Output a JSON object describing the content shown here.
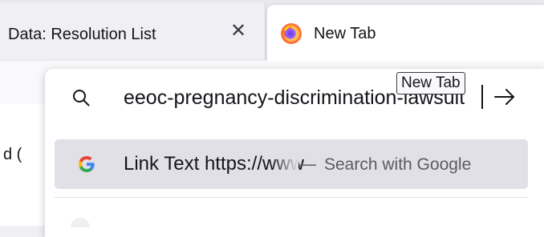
{
  "tabs": {
    "inactive": {
      "title": "Data: Resolution List",
      "close_icon": "close-icon"
    },
    "active": {
      "title": "New Tab",
      "icon": "firefox-icon"
    }
  },
  "tooltip": {
    "text": "New Tab"
  },
  "urlbar": {
    "value": "eeoc-pregnancy-discrimination-lawsuit",
    "search_icon": "search-icon",
    "go_icon": "arrow-right-icon"
  },
  "suggestion": {
    "icon": "google-icon",
    "title": "Link Text https://www",
    "separator": "—",
    "action": "Search with Google"
  },
  "page": {
    "fragment": "d ("
  },
  "colors": {
    "google_blue": "#4285F4",
    "google_red": "#EA4335",
    "google_yellow": "#FBBC05",
    "google_green": "#34A853",
    "firefox_orange": "#FF7139",
    "firefox_purple": "#7542E5"
  }
}
